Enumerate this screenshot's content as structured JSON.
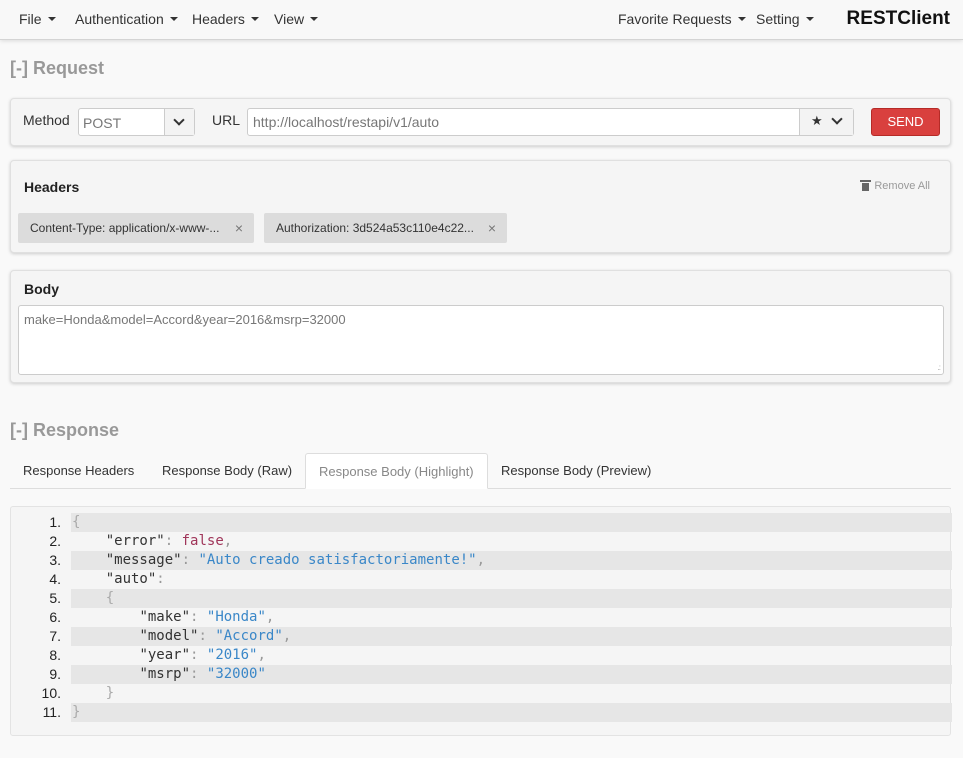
{
  "navbar": {
    "menus": [
      "File",
      "Authentication",
      "Headers",
      "View"
    ],
    "right_menus": [
      "Favorite Requests",
      "Setting"
    ],
    "brand": "RESTClient"
  },
  "request": {
    "section_title": "[-] Request",
    "method_label": "Method",
    "method_value": "POST",
    "url_label": "URL",
    "url_value": "http://localhost/restapi/v1/auto",
    "send_label": "SEND",
    "headers_title": "Headers",
    "remove_all_label": "Remove All",
    "headers": [
      "Content-Type: application/x-www-...",
      "Authorization: 3d524a53c110e4c22..."
    ],
    "body_title": "Body",
    "body_value": "make=Honda&model=Accord&year=2016&msrp=32000"
  },
  "response": {
    "section_title": "[-] Response",
    "tabs": [
      "Response Headers",
      "Response Body (Raw)",
      "Response Body (Highlight)",
      "Response Body (Preview)"
    ],
    "active_tab": "Response Body (Highlight)",
    "code_lines": [
      {
        "n": "1.",
        "text": "{"
      },
      {
        "n": "2.",
        "text": "    \"error\": false,"
      },
      {
        "n": "3.",
        "text": "    \"message\": \"Auto creado satisfactoriamente!\","
      },
      {
        "n": "4.",
        "text": "    \"auto\":"
      },
      {
        "n": "5.",
        "text": "    {"
      },
      {
        "n": "6.",
        "text": "        \"make\": \"Honda\","
      },
      {
        "n": "7.",
        "text": "        \"model\": \"Accord\","
      },
      {
        "n": "8.",
        "text": "        \"year\": \"2016\","
      },
      {
        "n": "9.",
        "text": "        \"msrp\": \"32000\""
      },
      {
        "n": "10.",
        "text": "    }"
      },
      {
        "n": "11.",
        "text": "}"
      }
    ]
  },
  "colors": {
    "send_button": "#d9403e",
    "string_token": "#3a87c8",
    "boolean_token": "#a0365a"
  }
}
